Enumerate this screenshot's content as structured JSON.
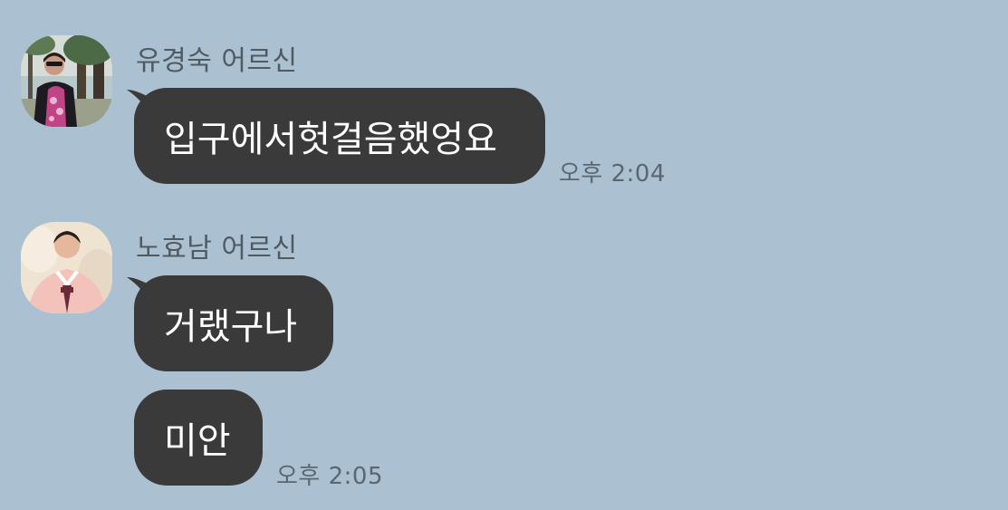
{
  "chat": {
    "background": "#abc1d1",
    "bubble_color": "#3a3a3a",
    "groups": [
      {
        "sender": "유경숙 어르신",
        "avatar_icon": "profile-photo-woman-trees-icon",
        "messages": [
          {
            "text": "입구에서헛걸음했엉요",
            "time": "오후 2:04"
          }
        ]
      },
      {
        "sender": "노효남 어르신",
        "avatar_icon": "profile-photo-woman-hanbok-icon",
        "messages": [
          {
            "text": "거랬구나",
            "time": ""
          },
          {
            "text": "미안",
            "time": "오후 2:05"
          }
        ]
      }
    ]
  }
}
